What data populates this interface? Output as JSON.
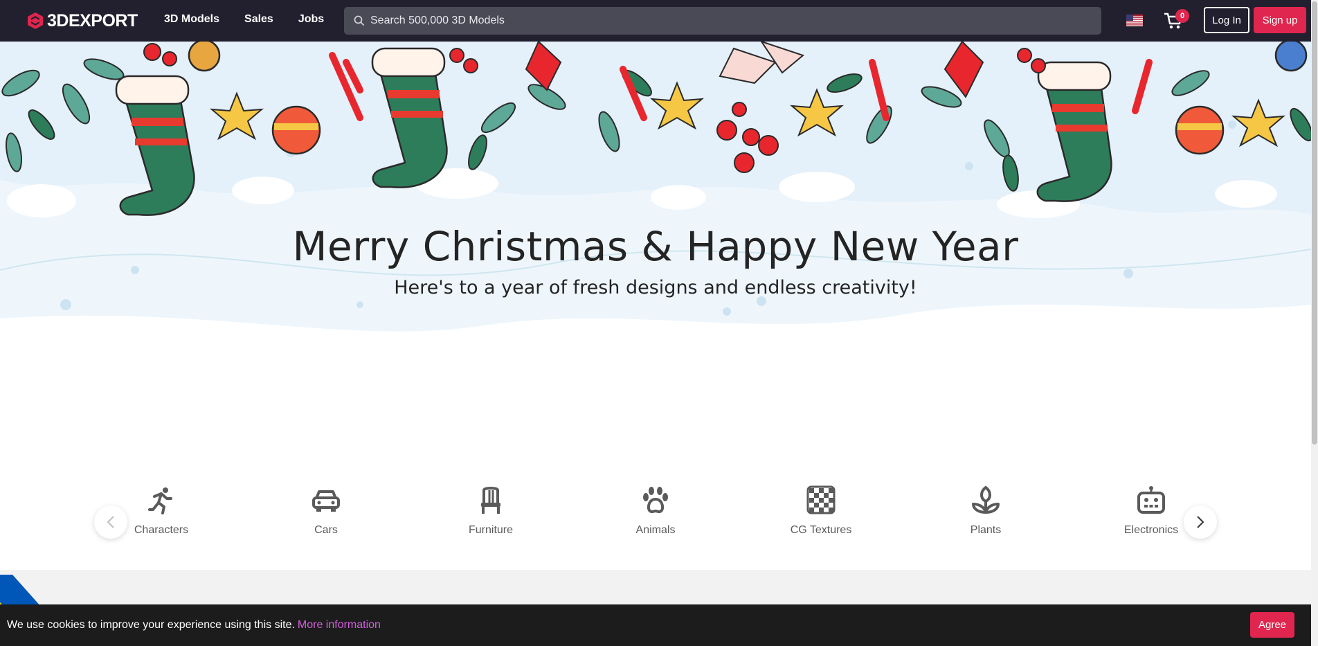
{
  "header": {
    "logo_text": "3DEXPORT",
    "nav": [
      "3D Models",
      "Sales",
      "Jobs"
    ],
    "search_placeholder": "Search 500,000 3D Models",
    "cart_count": "0",
    "login_label": "Log In",
    "signup_label": "Sign up"
  },
  "banner": {
    "title": "Merry Christmas & Happy New Year",
    "subtitle": "Here's to a year of fresh designs and endless creativity!"
  },
  "categories": [
    {
      "label": "Characters",
      "icon": "running-person-icon"
    },
    {
      "label": "Cars",
      "icon": "car-icon"
    },
    {
      "label": "Furniture",
      "icon": "chair-icon"
    },
    {
      "label": "Animals",
      "icon": "paw-icon"
    },
    {
      "label": "CG Textures",
      "icon": "checkerboard-icon"
    },
    {
      "label": "Plants",
      "icon": "plant-icon"
    },
    {
      "label": "Electronics",
      "icon": "robot-icon"
    }
  ],
  "cookie": {
    "message": "We use cookies to improve your experience using this site.",
    "link": "More information",
    "agree_label": "Agree"
  },
  "colors": {
    "header_bg": "#22202f",
    "accent": "#e0264e",
    "link": "#d65fe0"
  }
}
